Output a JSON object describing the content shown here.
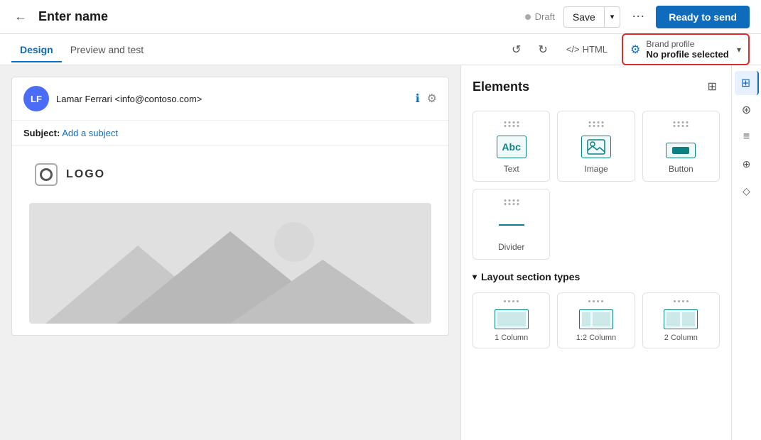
{
  "topbar": {
    "back_icon": "←",
    "title": "Enter name",
    "draft_label": "Draft",
    "save_label": "Save",
    "caret_icon": "▾",
    "more_icon": "⋯",
    "ready_label": "Ready to send"
  },
  "tabs": {
    "design_label": "Design",
    "preview_label": "Preview and test",
    "undo_icon": "↺",
    "redo_icon": "↻",
    "html_label": "HTML",
    "code_icon": "</>",
    "brand_profile": {
      "label": "Brand profile",
      "value": "No profile selected",
      "gear_icon": "⚙",
      "caret_icon": "▾"
    }
  },
  "email": {
    "avatar_initials": "LF",
    "sender": "Lamar Ferrari <info@contoso.com>",
    "subject_label": "Subject:",
    "subject_placeholder": "Add a subject",
    "logo_text": "LOGO"
  },
  "elements_panel": {
    "title": "Elements",
    "items": [
      {
        "id": "text",
        "label": "Text"
      },
      {
        "id": "image",
        "label": "Image"
      },
      {
        "id": "button",
        "label": "Button"
      },
      {
        "id": "divider",
        "label": "Divider"
      }
    ],
    "layout_section": {
      "title": "Layout section types",
      "items": [
        {
          "id": "1col",
          "label": "1 Column"
        },
        {
          "id": "12col",
          "label": "1:2 Column"
        },
        {
          "id": "2col",
          "label": "2 Column"
        }
      ]
    }
  },
  "far_right": {
    "icons": [
      {
        "id": "elements",
        "icon": "⊞",
        "active": true
      },
      {
        "id": "connect",
        "icon": "⊛",
        "active": false
      },
      {
        "id": "conditions",
        "icon": "≡",
        "active": false
      },
      {
        "id": "personalize",
        "icon": "⊕",
        "active": false
      },
      {
        "id": "accessibility",
        "icon": "◇",
        "active": false
      }
    ]
  }
}
